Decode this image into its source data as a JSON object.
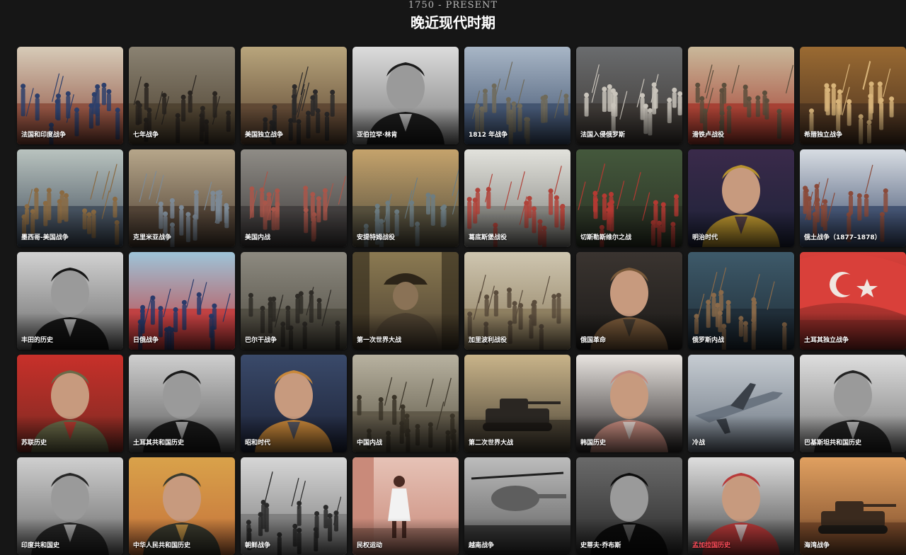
{
  "header": {
    "era_range": "1750 - PRESENT",
    "era_title": "晚近现代时期"
  },
  "cards": [
    {
      "label": "法国和印度战争",
      "art": "battle",
      "palette": [
        "#d7cbb8",
        "#8a4a3a",
        "#2d3f6b"
      ]
    },
    {
      "label": "七年战争",
      "art": "battle",
      "palette": [
        "#8a8272",
        "#4b3f2e",
        "#2a2520"
      ]
    },
    {
      "label": "美国独立战争",
      "art": "battle",
      "palette": [
        "#b8a57c",
        "#5a4330",
        "#2c2a2a"
      ]
    },
    {
      "label": "亚伯拉罕·林肯",
      "art": "portrait-bw",
      "palette": [
        "#dcdcdc",
        "#7a7a7a",
        "#1c1c1c"
      ]
    },
    {
      "label": "1812 年战争",
      "art": "battle",
      "palette": [
        "#a8b6c6",
        "#3d4f6b",
        "#6f6a5a"
      ]
    },
    {
      "label": "法国入侵俄罗斯",
      "art": "battle",
      "palette": [
        "#6a6c6e",
        "#3b3632",
        "#c9c4bb"
      ]
    },
    {
      "label": "滑铁卢战役",
      "art": "battle",
      "palette": [
        "#c9b89a",
        "#a33a2e",
        "#5c4e3c"
      ]
    },
    {
      "label": "希腊独立战争",
      "art": "battle",
      "palette": [
        "#9a6a32",
        "#4a3220",
        "#d8b47a"
      ]
    },
    {
      "label": "墨西哥-美国战争",
      "art": "battle",
      "palette": [
        "#b9c3bf",
        "#3e4a58",
        "#8a6a42"
      ]
    },
    {
      "label": "克里米亚战争",
      "art": "battle",
      "palette": [
        "#b6a68a",
        "#4a3c30",
        "#7d8a96"
      ]
    },
    {
      "label": "美国内战",
      "art": "battle",
      "palette": [
        "#8f8c86",
        "#3d3a3a",
        "#a9564a"
      ]
    },
    {
      "label": "安提特姆战役",
      "art": "battle",
      "palette": [
        "#c5a36c",
        "#4f4a3a",
        "#6d7d82"
      ]
    },
    {
      "label": "葛底斯堡战役",
      "art": "battle",
      "palette": [
        "#e2e2dc",
        "#7c7c78",
        "#b0433a"
      ]
    },
    {
      "label": "切斯勒斯维尔之战",
      "art": "battle",
      "palette": [
        "#44583c",
        "#2a3224",
        "#b43a32"
      ]
    },
    {
      "label": "明治时代",
      "art": "portrait-color",
      "palette": [
        "#3a2a4a",
        "#1d2238",
        "#b7922e"
      ]
    },
    {
      "label": "俄土战争（1877–1878）",
      "art": "battle",
      "palette": [
        "#d8dde3",
        "#3a4a6a",
        "#8a4a3a"
      ]
    },
    {
      "label": "丰田的历史",
      "art": "portrait-bw",
      "palette": [
        "#d2d2d2",
        "#6a6a6a",
        "#161616"
      ]
    },
    {
      "label": "日俄战争",
      "art": "battle",
      "palette": [
        "#9ec4d8",
        "#c2393a",
        "#2a3a6a"
      ]
    },
    {
      "label": "巴尔干战争",
      "art": "battle",
      "palette": [
        "#8d8a80",
        "#4e4a40",
        "#2e2b26"
      ]
    },
    {
      "label": "第一次世界大战",
      "art": "soldier",
      "palette": [
        "#8b7a52",
        "#4c4030",
        "#2c2418"
      ]
    },
    {
      "label": "加里波利战役",
      "art": "battle",
      "palette": [
        "#cfc6b0",
        "#8a7a5c",
        "#5a4c3c"
      ]
    },
    {
      "label": "俄国革命",
      "art": "portrait-color",
      "palette": [
        "#3a3430",
        "#1c1a18",
        "#7a5a3a"
      ]
    },
    {
      "label": "俄罗斯内战",
      "art": "battle",
      "palette": [
        "#3e5a6a",
        "#1e2c36",
        "#8a6a4a"
      ]
    },
    {
      "label": "土耳其独立战争",
      "art": "flag",
      "palette": [
        "#d9403a",
        "#8a2a26",
        "#f0e6e0"
      ]
    },
    {
      "label": "苏联历史",
      "art": "portrait-color",
      "palette": [
        "#c8302a",
        "#7a2a22",
        "#6a6a48"
      ]
    },
    {
      "label": "土耳其共和国历史",
      "art": "portrait-bw",
      "palette": [
        "#cfcfcf",
        "#5c5c5c",
        "#1a1a1a"
      ]
    },
    {
      "label": "昭和时代",
      "art": "portrait-color",
      "palette": [
        "#3a4a6a",
        "#1c2236",
        "#c9883a"
      ]
    },
    {
      "label": "中国内战",
      "art": "battle",
      "palette": [
        "#b8b2a0",
        "#5a5444",
        "#3a3428"
      ]
    },
    {
      "label": "第二次世界大战",
      "art": "tank",
      "palette": [
        "#c9b48a",
        "#4a4234",
        "#2a2622"
      ]
    },
    {
      "label": "韩国历史",
      "art": "portrait-color",
      "palette": [
        "#e8e4e0",
        "#2a2626",
        "#c48a7e"
      ]
    },
    {
      "label": "冷战",
      "art": "jet",
      "palette": [
        "#c6ccd2",
        "#6a7480",
        "#3a4048"
      ]
    },
    {
      "label": "巴基斯坦共和国历史",
      "art": "portrait-bw",
      "palette": [
        "#dedede",
        "#7a7a7a",
        "#222222"
      ]
    },
    {
      "label": "印度共和国史",
      "art": "portrait-bw",
      "palette": [
        "#cfcfcf",
        "#6a6a6a",
        "#262626"
      ]
    },
    {
      "label": "中华人民共和国历史",
      "art": "portrait-color",
      "palette": [
        "#d9a24a",
        "#c4703a",
        "#3a3a2e"
      ]
    },
    {
      "label": "朝鲜战争",
      "art": "battle",
      "palette": [
        "#d6d6d6",
        "#7a7a7a",
        "#2a2a2a"
      ]
    },
    {
      "label": "民权运动",
      "art": "scene",
      "palette": [
        "#e6c2b6",
        "#c98a7a",
        "#4a2a22"
      ]
    },
    {
      "label": "越南战争",
      "art": "heli",
      "palette": [
        "#bcbcbc",
        "#5e5e5e",
        "#1e1e1e"
      ]
    },
    {
      "label": "史蒂夫·乔布斯",
      "art": "portrait-bw",
      "palette": [
        "#6a6a6a",
        "#2a2a2a",
        "#0c0c0c"
      ]
    },
    {
      "label": "孟加拉国历史",
      "art": "portrait-color",
      "palette": [
        "#dedede",
        "#4a4a4a",
        "#b83a3a"
      ],
      "highlight": true
    },
    {
      "label": "海湾战争",
      "art": "tank",
      "palette": [
        "#e0a060",
        "#7a4a2a",
        "#3a2a1e"
      ]
    }
  ]
}
